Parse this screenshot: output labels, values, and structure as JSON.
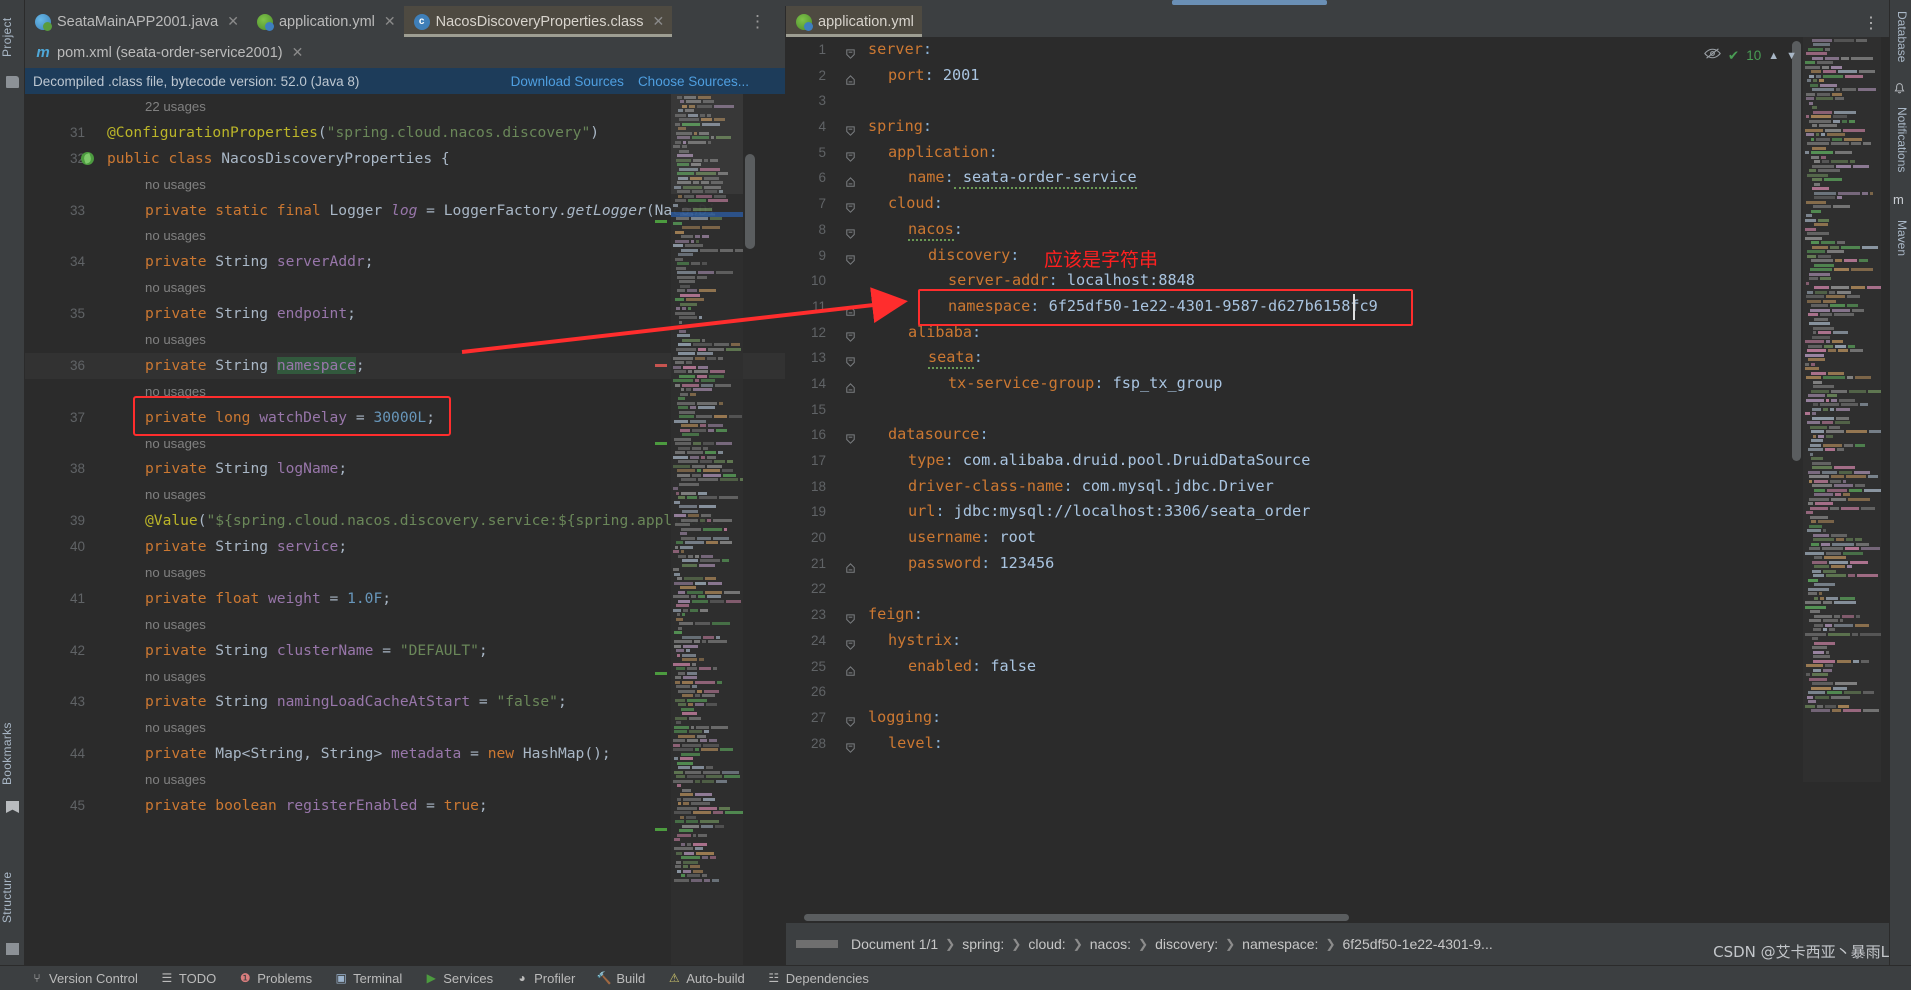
{
  "tabs_left": [
    {
      "label": "SeataMainAPP2001.java",
      "icon": "java-class-icon",
      "active": false
    },
    {
      "label": "application.yml",
      "icon": "yaml-file-icon",
      "active": false
    },
    {
      "label": "NacosDiscoveryProperties.class",
      "icon": "compiled-class-icon",
      "active": true
    }
  ],
  "tabs_left_row2": [
    {
      "label": "pom.xml (seata-order-service2001)",
      "icon": "maven-file-icon",
      "active": false
    }
  ],
  "tabs_right": [
    {
      "label": "application.yml",
      "icon": "yaml-file-icon",
      "active": true
    }
  ],
  "notice": {
    "text": "Decompiled .class file, bytecode version: 52.0 (Java 8)",
    "download_sources": "Download Sources",
    "choose_sources": "Choose Sources..."
  },
  "left_code": {
    "usages_header": "22 usages",
    "lines": [
      {
        "num": "",
        "kind": "usage",
        "text": "22 usages"
      },
      {
        "num": "31",
        "kind": "code",
        "segments": [
          {
            "t": "@ConfigurationProperties",
            "c": "ann"
          },
          {
            "t": "(",
            "c": "pl"
          },
          {
            "t": "\"spring.cloud.nacos.discovery\"",
            "c": "str"
          },
          {
            "t": ")",
            "c": "pl"
          }
        ]
      },
      {
        "num": "32",
        "kind": "code",
        "bean": true,
        "segments": [
          {
            "t": "public ",
            "c": "kw"
          },
          {
            "t": "class ",
            "c": "kw"
          },
          {
            "t": "NacosDiscoveryProperties ",
            "c": "cls"
          },
          {
            "t": "{",
            "c": "pl"
          }
        ]
      },
      {
        "num": "",
        "kind": "usage",
        "text": "no usages"
      },
      {
        "num": "33",
        "kind": "code",
        "indent": 1,
        "segments": [
          {
            "t": "private static final ",
            "c": "kw"
          },
          {
            "t": "Logger ",
            "c": "cls"
          },
          {
            "t": "log",
            "c": "fld ital"
          },
          {
            "t": " = ",
            "c": "pl"
          },
          {
            "t": "LoggerFactory.",
            "c": "cls"
          },
          {
            "t": "getLogger",
            "c": "cls ital"
          },
          {
            "t": "(NacosDi",
            "c": "pl"
          }
        ]
      },
      {
        "num": "",
        "kind": "usage",
        "text": "no usages"
      },
      {
        "num": "34",
        "kind": "code",
        "indent": 1,
        "segments": [
          {
            "t": "private ",
            "c": "kw"
          },
          {
            "t": "String ",
            "c": "cls"
          },
          {
            "t": "serverAddr",
            "c": "fld"
          },
          {
            "t": ";",
            "c": "pl"
          }
        ]
      },
      {
        "num": "",
        "kind": "usage",
        "text": "no usages"
      },
      {
        "num": "35",
        "kind": "code",
        "indent": 1,
        "segments": [
          {
            "t": "private ",
            "c": "kw"
          },
          {
            "t": "String ",
            "c": "cls"
          },
          {
            "t": "endpoint",
            "c": "fld"
          },
          {
            "t": ";",
            "c": "pl"
          }
        ]
      },
      {
        "num": "",
        "kind": "usage",
        "text": "no usages"
      },
      {
        "num": "36",
        "kind": "code",
        "indent": 1,
        "highlight": true,
        "segments": [
          {
            "t": "private ",
            "c": "kw"
          },
          {
            "t": "String ",
            "c": "cls"
          },
          {
            "t": "namespace",
            "c": "fld green-hl"
          },
          {
            "t": ";",
            "c": "pl"
          }
        ]
      },
      {
        "num": "",
        "kind": "usage",
        "text": "no usages"
      },
      {
        "num": "37",
        "kind": "code",
        "indent": 1,
        "segments": [
          {
            "t": "private ",
            "c": "kw"
          },
          {
            "t": "long ",
            "c": "kw"
          },
          {
            "t": "watchDelay",
            "c": "fld"
          },
          {
            "t": " = ",
            "c": "pl"
          },
          {
            "t": "30000L",
            "c": "num"
          },
          {
            "t": ";",
            "c": "pl"
          }
        ]
      },
      {
        "num": "",
        "kind": "usage",
        "text": "no usages"
      },
      {
        "num": "38",
        "kind": "code",
        "indent": 1,
        "segments": [
          {
            "t": "private ",
            "c": "kw"
          },
          {
            "t": "String ",
            "c": "cls"
          },
          {
            "t": "logName",
            "c": "fld"
          },
          {
            "t": ";",
            "c": "pl"
          }
        ]
      },
      {
        "num": "",
        "kind": "usage",
        "text": "no usages"
      },
      {
        "num": "39",
        "kind": "code",
        "indent": 1,
        "segments": [
          {
            "t": "@Value",
            "c": "ann"
          },
          {
            "t": "(",
            "c": "pl"
          },
          {
            "t": "\"${spring.cloud.nacos.discovery.service:${spring.applicati",
            "c": "str"
          }
        ]
      },
      {
        "num": "40",
        "kind": "code",
        "indent": 1,
        "segments": [
          {
            "t": "private ",
            "c": "kw"
          },
          {
            "t": "String ",
            "c": "cls"
          },
          {
            "t": "service",
            "c": "fld"
          },
          {
            "t": ";",
            "c": "pl"
          }
        ]
      },
      {
        "num": "",
        "kind": "usage",
        "text": "no usages"
      },
      {
        "num": "41",
        "kind": "code",
        "indent": 1,
        "segments": [
          {
            "t": "private ",
            "c": "kw"
          },
          {
            "t": "float ",
            "c": "kw"
          },
          {
            "t": "weight",
            "c": "fld"
          },
          {
            "t": " = ",
            "c": "pl"
          },
          {
            "t": "1.0F",
            "c": "num"
          },
          {
            "t": ";",
            "c": "pl"
          }
        ]
      },
      {
        "num": "",
        "kind": "usage",
        "text": "no usages"
      },
      {
        "num": "42",
        "kind": "code",
        "indent": 1,
        "segments": [
          {
            "t": "private ",
            "c": "kw"
          },
          {
            "t": "String ",
            "c": "cls"
          },
          {
            "t": "clusterName",
            "c": "fld"
          },
          {
            "t": " = ",
            "c": "pl"
          },
          {
            "t": "\"DEFAULT\"",
            "c": "str"
          },
          {
            "t": ";",
            "c": "pl"
          }
        ]
      },
      {
        "num": "",
        "kind": "usage",
        "text": "no usages"
      },
      {
        "num": "43",
        "kind": "code",
        "indent": 1,
        "segments": [
          {
            "t": "private ",
            "c": "kw"
          },
          {
            "t": "String ",
            "c": "cls"
          },
          {
            "t": "namingLoadCacheAtStart",
            "c": "fld"
          },
          {
            "t": " = ",
            "c": "pl"
          },
          {
            "t": "\"false\"",
            "c": "str"
          },
          {
            "t": ";",
            "c": "pl"
          }
        ]
      },
      {
        "num": "",
        "kind": "usage",
        "text": "no usages"
      },
      {
        "num": "44",
        "kind": "code",
        "indent": 1,
        "segments": [
          {
            "t": "private ",
            "c": "kw"
          },
          {
            "t": "Map<String, String> ",
            "c": "cls"
          },
          {
            "t": "metadata",
            "c": "fld"
          },
          {
            "t": " = ",
            "c": "pl"
          },
          {
            "t": "new ",
            "c": "kw"
          },
          {
            "t": "HashMap",
            "c": "cls"
          },
          {
            "t": "();",
            "c": "pl"
          }
        ]
      },
      {
        "num": "",
        "kind": "usage",
        "text": "no usages"
      },
      {
        "num": "45",
        "kind": "code",
        "indent": 1,
        "segments": [
          {
            "t": "private ",
            "c": "kw"
          },
          {
            "t": "boolean ",
            "c": "kw"
          },
          {
            "t": "registerEnabled",
            "c": "fld"
          },
          {
            "t": " = ",
            "c": "pl"
          },
          {
            "t": "true",
            "c": "kw"
          },
          {
            "t": ";",
            "c": "pl"
          }
        ]
      }
    ]
  },
  "right_code": {
    "lines": [
      {
        "num": "1",
        "indent": 0,
        "fold": "down",
        "key": "server",
        "value": ""
      },
      {
        "num": "2",
        "indent": 1,
        "fold": "end",
        "key": "port",
        "value": "2001"
      },
      {
        "num": "3",
        "indent": 0,
        "fold": "",
        "key": "",
        "value": ""
      },
      {
        "num": "4",
        "indent": 0,
        "fold": "down",
        "key": "spring",
        "value": ""
      },
      {
        "num": "5",
        "indent": 1,
        "fold": "down",
        "key": "application",
        "value": ""
      },
      {
        "num": "6",
        "indent": 2,
        "fold": "end",
        "key": "name",
        "value": "seata-order-service",
        "wavy_value": true
      },
      {
        "num": "7",
        "indent": 1,
        "fold": "down",
        "key": "cloud",
        "value": ""
      },
      {
        "num": "8",
        "indent": 2,
        "fold": "down",
        "key": "nacos",
        "value": "",
        "wavy_key": true
      },
      {
        "num": "9",
        "indent": 3,
        "fold": "down",
        "key": "discovery",
        "value": ""
      },
      {
        "num": "10",
        "indent": 4,
        "fold": "",
        "key": "server-addr",
        "value": "localhost:8848"
      },
      {
        "num": "11",
        "indent": 4,
        "fold": "end",
        "key": "namespace",
        "value": "6f25df50-1e22-4301-9587-d627b6158fc9",
        "boxed": true
      },
      {
        "num": "12",
        "indent": 2,
        "fold": "down",
        "key": "alibaba",
        "value": ""
      },
      {
        "num": "13",
        "indent": 3,
        "fold": "down",
        "key": "seata",
        "value": "",
        "wavy_key": true
      },
      {
        "num": "14",
        "indent": 4,
        "fold": "end",
        "key": "tx-service-group",
        "value": "fsp_tx_group"
      },
      {
        "num": "15",
        "indent": 0,
        "fold": "",
        "key": "",
        "value": ""
      },
      {
        "num": "16",
        "indent": 1,
        "fold": "down",
        "key": "datasource",
        "value": ""
      },
      {
        "num": "17",
        "indent": 2,
        "fold": "",
        "key": "type",
        "value": "com.alibaba.druid.pool.DruidDataSource"
      },
      {
        "num": "18",
        "indent": 2,
        "fold": "",
        "key": "driver-class-name",
        "value": "com.mysql.jdbc.Driver"
      },
      {
        "num": "19",
        "indent": 2,
        "fold": "",
        "key": "url",
        "value": "jdbc:mysql://localhost:3306/seata_order"
      },
      {
        "num": "20",
        "indent": 2,
        "fold": "",
        "key": "username",
        "value": "root"
      },
      {
        "num": "21",
        "indent": 2,
        "fold": "end",
        "key": "password",
        "value": "123456"
      },
      {
        "num": "22",
        "indent": 0,
        "fold": "",
        "key": "",
        "value": ""
      },
      {
        "num": "23",
        "indent": 0,
        "fold": "down",
        "key": "feign",
        "value": ""
      },
      {
        "num": "24",
        "indent": 1,
        "fold": "down",
        "key": "hystrix",
        "value": ""
      },
      {
        "num": "25",
        "indent": 2,
        "fold": "end",
        "key": "enabled",
        "value": "false"
      },
      {
        "num": "26",
        "indent": 0,
        "fold": "",
        "key": "",
        "value": ""
      },
      {
        "num": "27",
        "indent": 0,
        "fold": "down",
        "key": "logging",
        "value": ""
      },
      {
        "num": "28",
        "indent": 1,
        "fold": "down",
        "key": "level",
        "value": ""
      }
    ]
  },
  "annotation": {
    "chinese_note": "应该是字符串",
    "color": "#ff2020"
  },
  "inspections": {
    "count": "10",
    "eye_icon": "eye-off-icon",
    "up_icon": "chevron-up-icon",
    "down_icon": "chevron-down-icon"
  },
  "breadcrumb": {
    "document": "Document 1/1",
    "path": [
      "spring:",
      "cloud:",
      "nacos:",
      "discovery:",
      "namespace:",
      "6f25df50-1e22-4301-9..."
    ]
  },
  "bottom_bar": [
    {
      "label": "Version Control",
      "icon": "branch-icon"
    },
    {
      "label": "TODO",
      "icon": "list-icon"
    },
    {
      "label": "Problems",
      "icon": "warning-circle-icon"
    },
    {
      "label": "Terminal",
      "icon": "terminal-icon"
    },
    {
      "label": "Services",
      "icon": "play-circle-icon"
    },
    {
      "label": "Profiler",
      "icon": "gauge-icon"
    },
    {
      "label": "Build",
      "icon": "hammer-icon"
    },
    {
      "label": "Auto-build",
      "icon": "warning-triangle-icon"
    },
    {
      "label": "Dependencies",
      "icon": "layers-icon"
    }
  ],
  "left_tool_strip": [
    "Project",
    "Bookmarks",
    "Structure"
  ],
  "right_tool_strip": [
    "Database",
    "Notifications",
    "Maven"
  ],
  "watermark": "CSDN @艾卡西亚丶暴雨L"
}
